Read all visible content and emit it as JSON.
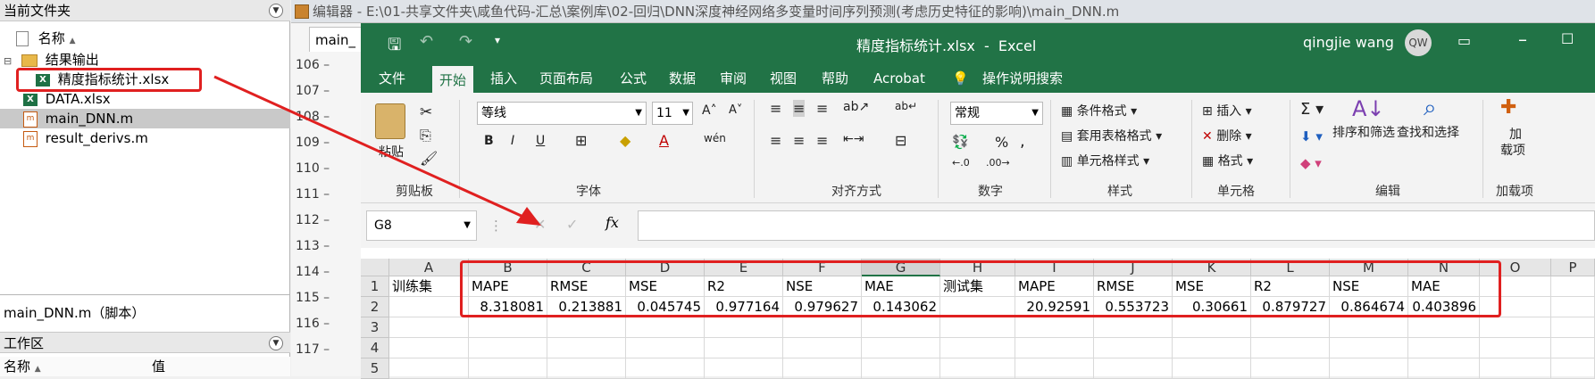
{
  "left_panel": {
    "current_folder_title": "当前文件夹",
    "col_name": "名称",
    "sort_arrow": "▲",
    "tree": [
      {
        "label": "结果输出",
        "type": "folder"
      },
      {
        "label": "精度指标统计.xlsx",
        "type": "xlsx",
        "highlighted": true
      },
      {
        "label": "DATA.xlsx",
        "type": "xlsx"
      },
      {
        "label": "main_DNN.m",
        "type": "m",
        "selected": true
      },
      {
        "label": "result_derivs.m",
        "type": "m"
      }
    ],
    "details_label": "main_DNN.m（脚本）",
    "workspace_title": "工作区",
    "ws_col_name": "名称",
    "ws_sort_arrow": "▲",
    "ws_col_value": "值"
  },
  "editor": {
    "title": "编辑器 - E:\\01-共享文件夹\\咸鱼代码-汇总\\案例库\\02-回归\\DNN深度神经网络多变量时间序列预测(考虑历史特征的影响)\\main_DNN.m",
    "tab_label": "main_",
    "line_numbers": [
      "106",
      "107",
      "108",
      "109",
      "110",
      "111",
      "112",
      "113",
      "114",
      "115",
      "116",
      "117"
    ]
  },
  "excel": {
    "window_title": "精度指标统计.xlsx  -  Excel",
    "user_name": "qingjie wang",
    "user_initials": "QW",
    "tabs": [
      "文件",
      "开始",
      "插入",
      "页面布局",
      "公式",
      "数据",
      "审阅",
      "视图",
      "帮助",
      "Acrobat"
    ],
    "active_tab": "开始",
    "tell_me": "操作说明搜索",
    "ribbon": {
      "paste_label": "粘贴",
      "clipboard_group": "剪贴板",
      "font_name": "等线",
      "font_size": "11",
      "font_group": "字体",
      "bold": "B",
      "italic": "I",
      "underline": "U",
      "align_group": "对齐方式",
      "number_format": "常规",
      "number_group": "数字",
      "percent": "%",
      "comma": ",",
      "cond_format": "条件格式",
      "table_format": "套用表格格式",
      "cell_style": "单元格样式",
      "styles_group": "样式",
      "insert": "插入",
      "delete": "删除",
      "format": "格式",
      "cells_group": "单元格",
      "sort_filter": "排序和筛选",
      "find_select": "查找和选择",
      "editing_group": "编辑",
      "addin_top": "加",
      "addin_bottom": "载项",
      "addin_group": "加载项"
    },
    "name_box": "G8",
    "fx": "fx",
    "columns": [
      "A",
      "B",
      "C",
      "D",
      "E",
      "F",
      "G",
      "H",
      "I",
      "J",
      "K",
      "L",
      "M",
      "N",
      "O",
      "P"
    ],
    "rows": [
      "1",
      "2",
      "3",
      "4",
      "5"
    ],
    "sheet": {
      "row1": [
        "训练集",
        "MAPE",
        "RMSE",
        "MSE",
        "R2",
        "NSE",
        "MAE",
        "测试集",
        "MAPE",
        "RMSE",
        "MSE",
        "R2",
        "NSE",
        "MAE"
      ],
      "row2": [
        "",
        "8.318081",
        "0.213881",
        "0.045745",
        "0.977164",
        "0.979627",
        "0.143062",
        "",
        "20.92591",
        "0.553723",
        "0.30661",
        "0.879727",
        "0.864674",
        "0.403896"
      ]
    }
  },
  "colors": {
    "excel_green": "#217346",
    "annotation_red": "#e02020"
  }
}
